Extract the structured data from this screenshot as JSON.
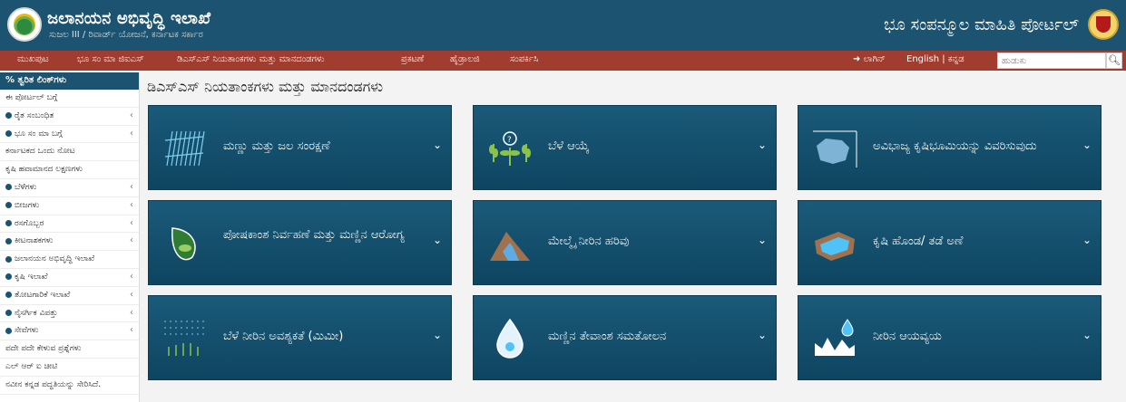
{
  "header": {
    "title": "ಜಲಾನಯನ ಅಭಿವೃದ್ಧಿ ಇಲಾಖೆ",
    "subtitle": "ಸುಜಲ III / ರಿವಾರ್ಡ್ ಯೋಜನೆ, ಕರ್ನಾಟಕ ಸರ್ಕಾರ",
    "portal_title": "ಭೂ ಸಂಪನ್ಮೂಲ ಮಾಹಿತಿ ಪೋರ್ಟಲ್"
  },
  "nav": {
    "items": [
      "ಮುಖಪುಟ",
      "ಭೂ ಸಂ ಮಾ ಜಿಐಎಸ್",
      "ಡಿಎಸ್ಎಸ್ ನಿಯತಾಂಕಗಳು ಮತ್ತು ಮಾನದಂಡಗಳು",
      "ಪ್ರಕಟಣೆ",
      "ಹೈಡ್ರಾಲಜಿ",
      "ಸಂಪರ್ಕಿಸಿ"
    ],
    "login": "➜ ಲಾಗಿನ್",
    "lang": "English | ಕನ್ನಡ",
    "search_placeholder": "ಹುಡುಕು",
    "search_icon": "magnifier-icon"
  },
  "sidebar": {
    "header": "% ತ್ವರಿತ ಲಿಂಕ್‌ಗಳು",
    "items": [
      {
        "label": "ಈ ಪೋರ್ಟಲ್ ಬಗ್ಗೆ",
        "bullet": false,
        "caret": false
      },
      {
        "label": "ರೈತ ಸಂಬಂಧಿತ",
        "bullet": true,
        "caret": true
      },
      {
        "label": "ಭೂ ಸಂ ಮಾ ಬಗ್ಗೆ",
        "bullet": true,
        "caret": true
      },
      {
        "label": "ಕರ್ನಾಟಕದ ಒಂದು ನೋಟ",
        "bullet": false,
        "caret": false
      },
      {
        "label": "ಕೃಷಿ ಹವಾಮಾನದ ಲಕ್ಷಣಗಳು",
        "bullet": false,
        "caret": false
      },
      {
        "label": "ಬೆಳೆಗಳು",
        "bullet": true,
        "caret": true
      },
      {
        "label": "ಬೀಜಗಳು",
        "bullet": true,
        "caret": true
      },
      {
        "label": "ರಸಗೊಬ್ಬರ",
        "bullet": true,
        "caret": true
      },
      {
        "label": "ಕೀಟನಾಶಕಗಳು",
        "bullet": true,
        "caret": true
      },
      {
        "label": "ಜಲಾನಯನ ಅಭಿವೃದ್ಧಿ ಇಲಾಖೆ",
        "bullet": true,
        "caret": false
      },
      {
        "label": "ಕೃಷಿ ಇಲಾಖೆ",
        "bullet": true,
        "caret": true
      },
      {
        "label": "ತೋಟಗಾರಿಕೆ ಇಲಾಖೆ",
        "bullet": true,
        "caret": true
      },
      {
        "label": "ನೈಸರ್ಗಿಕ ವಿಪತ್ತು",
        "bullet": true,
        "caret": true
      },
      {
        "label": "ಸೇವೆಗಳು",
        "bullet": true,
        "caret": true
      },
      {
        "label": "ಪದೇ ಪದೇ ಕೇಳುವ ಪ್ರಶ್ನೆಗಳು",
        "bullet": false,
        "caret": false
      },
      {
        "label": "ಎಲ್ ಆರ್ ಐ ಚೀಟಿ",
        "bullet": false,
        "caret": false
      },
      {
        "label": "ನವೀನ ಕನ್ನಡ ಪದ್ಧತಿಯನ್ನು ಸೇರಿಸಿದೆ.",
        "bullet": false,
        "caret": false
      }
    ]
  },
  "main": {
    "heading": "ಡಿಎಸ್ಎಸ್ ನಿಯತಾಂಕಗಳು ಮತ್ತು ಮಾನದಂಡಗಳು",
    "chevron": "⌄",
    "tiles": [
      {
        "label": "ಮಣ್ಣು ಮತ್ತು ಜಲ ಸಂರಕ್ಷಣೆ",
        "icon": "soil-water-lines-icon"
      },
      {
        "label": "ಬೆಳೆ ಆಯ್ಕೆ",
        "icon": "crop-selection-icon"
      },
      {
        "label": "ಅವಿಭಾಜ್ಯ ಕೃಷಿಭೂಮಿಯನ್ನು ವಿವರಿಸುವುದು",
        "icon": "land-parcel-icon"
      },
      {
        "label": "ಪೋಷಕಾಂಶ ನಿರ್ವಹಣೆ ಮತ್ತು ಮಣ್ಣಿನ ಆರೋಗ್ಯ",
        "icon": "nutrient-leaf-icon"
      },
      {
        "label": "ಮೇಲ್ಮೈ ನೀರಿನ ಹರಿವು",
        "icon": "surface-runoff-icon"
      },
      {
        "label": "ಕೃಷಿ ಹೊಂಡ/ ತಡೆ ಅಣೆ",
        "icon": "farm-pond-icon"
      },
      {
        "label": "ಬೆಳೆ ನೀರಿನ ಅವಶ್ಯಕತೆ (ಮಿಮೀ)",
        "icon": "crop-water-icon"
      },
      {
        "label": "ಮಣ್ಣಿನ ತೇವಾಂಶ ಸಮತೋಲನ",
        "icon": "soil-moisture-drop-icon"
      },
      {
        "label": "ನೀರಿನ ಆಯವ್ಯಯ",
        "icon": "water-budget-icon"
      }
    ]
  }
}
